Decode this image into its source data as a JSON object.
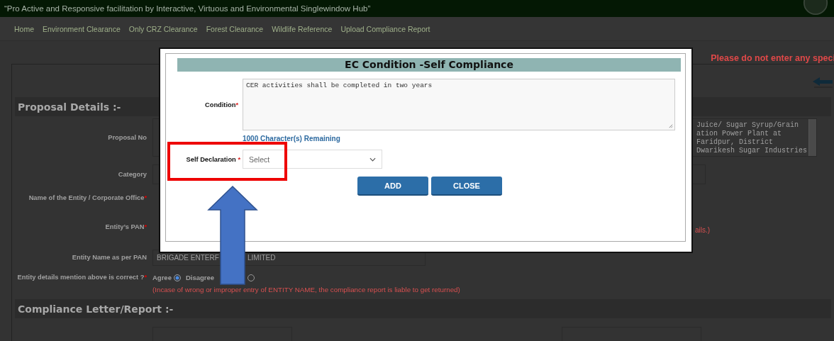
{
  "header": {
    "tagline": "“Pro Active and Responsive facilitation by Interactive, Virtuous and Environmental Singlewindow Hub”"
  },
  "nav": [
    {
      "label": "Home"
    },
    {
      "label": "Environment Clearance"
    },
    {
      "label": "Only CRZ Clearance"
    },
    {
      "label": "Forest Clearance"
    },
    {
      "label": "Wildlife Reference"
    },
    {
      "label": "Upload Compliance Report"
    }
  ],
  "notice": "Please do not enter any speci",
  "required_mark": "*",
  "proposal_details": {
    "title": "Proposal Details :-",
    "fields": [
      {
        "kind": "textarea",
        "label": "Proposal No",
        "required": false,
        "lines": [
          "Juice/ Sugar Syrup/Grain",
          "ation Power Plant at",
          "Faridpur, District",
          "Dwarikesh Sugar Industries"
        ]
      },
      {
        "kind": "input",
        "label": "Category",
        "required": false
      },
      {
        "kind": "blank",
        "label": "Name of the Entity / Corporate Office",
        "required": true
      },
      {
        "kind": "note",
        "label": "Entity’s PAN",
        "required": true,
        "note": "ails.)"
      },
      {
        "kind": "split_input",
        "label": "Entity Name as per PAN",
        "required": false,
        "parts": [
          "BRIGADE ENTERF",
          "LIMITED"
        ]
      },
      {
        "kind": "radio",
        "label": "Entity details mention above is correct ?",
        "required": true,
        "options": [
          {
            "label": "Agree",
            "selected": true
          },
          {
            "label": "Disagree",
            "selected": false
          }
        ],
        "note": "(Incase of wrong or improper entry of ENTITY NAME, the compliance report is liable to get returned)"
      }
    ]
  },
  "compliance": {
    "title": "Compliance Letter/Report :-"
  },
  "modal": {
    "title": "EC Condition -Self Compliance",
    "condition_label": "Condition",
    "condition_text": "CER activities shall be completed in two years",
    "remaining": "1000 Character(s) Remaining",
    "declaration_label": "Self Declaration",
    "declaration_placeholder": "Select",
    "buttons": [
      "ADD",
      "CLOSE"
    ]
  }
}
